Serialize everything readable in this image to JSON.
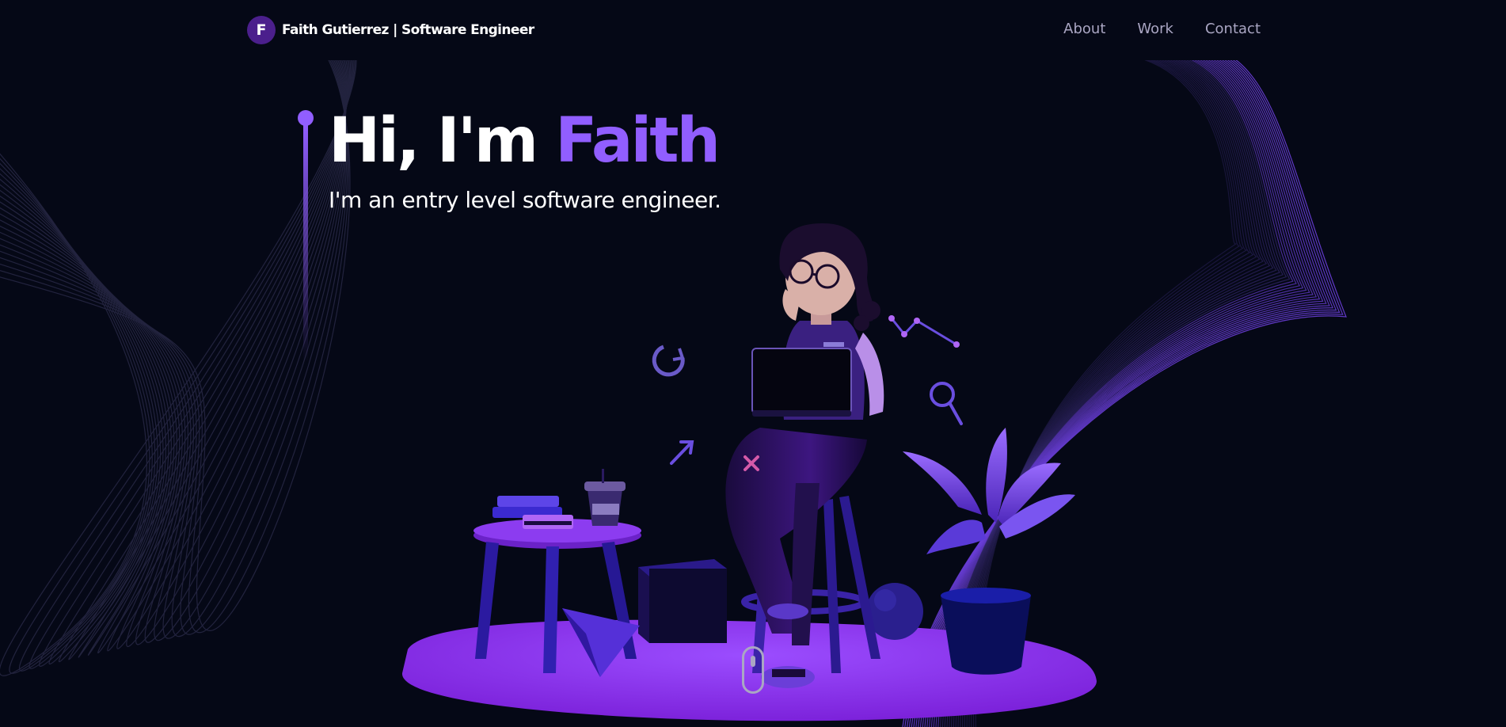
{
  "navbar": {
    "logo_letter": "F",
    "brand_title": "Faith Gutierrez | Software Engineer",
    "links": [
      {
        "label": "About"
      },
      {
        "label": "Work"
      },
      {
        "label": "Contact"
      }
    ]
  },
  "hero": {
    "greeting": "Hi, I'm ",
    "name": "Faith",
    "subtitle": "I'm an entry level software engineer."
  },
  "colors": {
    "background": "#050816",
    "accent": "#915eff",
    "nav_text": "#aaa6c3",
    "platform": "#8a2be2"
  },
  "illustration": {
    "icon": "girl-with-laptop-3d-scene"
  }
}
